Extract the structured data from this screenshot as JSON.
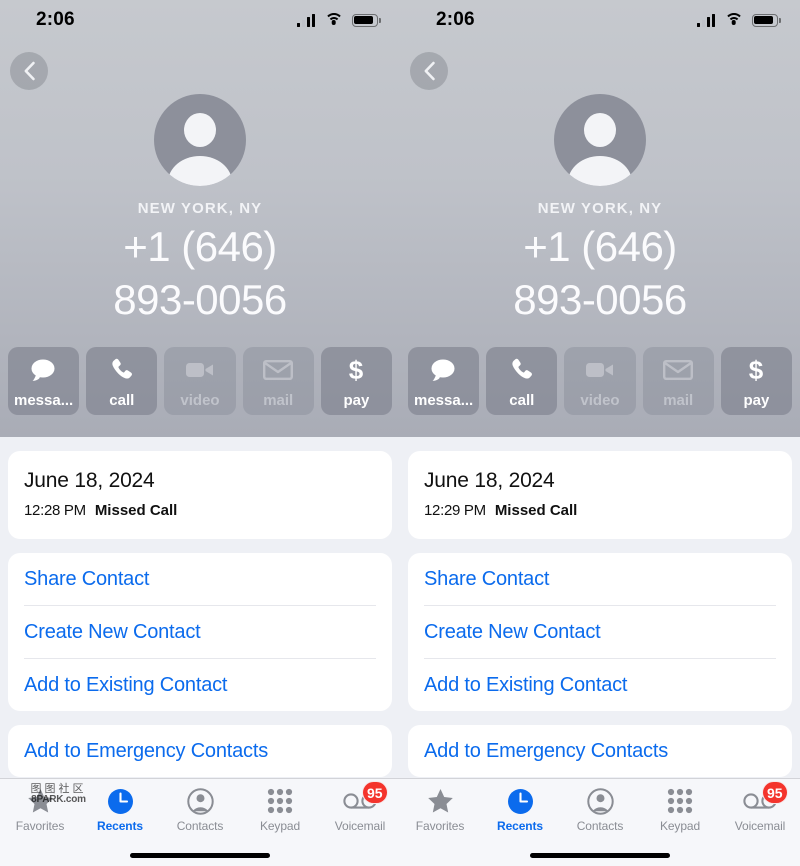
{
  "device": {
    "status_bar": {
      "time": "2:06",
      "signal_icon": "cellular-signal-icon",
      "wifi_icon": "wifi-icon",
      "battery_icon": "battery-icon"
    },
    "home_indicator": "home-indicator"
  },
  "colors": {
    "link_blue": "#0b6bed",
    "badge_red": "#f4342c",
    "hero_gray_top": "#c6c9ce",
    "hero_gray_bottom": "#a9acb6",
    "content_bg": "#eef0f5",
    "card_white": "#ffffff",
    "tab_inactive": "#8a8d94"
  },
  "watermark": {
    "cn_text": "图图社区",
    "en_text": "8PARK.com"
  },
  "panels": [
    {
      "id": "left",
      "back_button": "back-chevron",
      "avatar": "default-contact-avatar",
      "locality": "NEW YORK, NY",
      "phone_line1": "+1 (646)",
      "phone_line2": "893-0056",
      "actions": [
        {
          "label": "messa...",
          "icon": "message-bubble-icon",
          "enabled": true
        },
        {
          "label": "call",
          "icon": "phone-handset-icon",
          "enabled": true
        },
        {
          "label": "video",
          "icon": "video-camera-icon",
          "enabled": false
        },
        {
          "label": "mail",
          "icon": "envelope-icon",
          "enabled": false
        },
        {
          "label": "pay",
          "icon": "dollar-sign-icon",
          "enabled": true
        }
      ],
      "call_entry": {
        "date": "June 18, 2024",
        "time": "12:28 PM",
        "type": "Missed Call"
      },
      "contact_actions": [
        "Share Contact",
        "Create New Contact",
        "Add to Existing Contact"
      ],
      "emergency_action": "Add to Emergency Contacts",
      "tabs": [
        {
          "label": "Favorites",
          "icon": "star-icon",
          "active": false,
          "badge": null
        },
        {
          "label": "Recents",
          "icon": "clock-icon",
          "active": true,
          "badge": null
        },
        {
          "label": "Contacts",
          "icon": "person-circle-icon",
          "active": false,
          "badge": null
        },
        {
          "label": "Keypad",
          "icon": "keypad-grid-icon",
          "active": false,
          "badge": null
        },
        {
          "label": "Voicemail",
          "icon": "voicemail-icon",
          "active": false,
          "badge": "95"
        }
      ]
    },
    {
      "id": "right",
      "back_button": "back-chevron",
      "avatar": "default-contact-avatar",
      "locality": "NEW YORK, NY",
      "phone_line1": "+1 (646)",
      "phone_line2": "893-0056",
      "actions": [
        {
          "label": "messa...",
          "icon": "message-bubble-icon",
          "enabled": true
        },
        {
          "label": "call",
          "icon": "phone-handset-icon",
          "enabled": true
        },
        {
          "label": "video",
          "icon": "video-camera-icon",
          "enabled": false
        },
        {
          "label": "mail",
          "icon": "envelope-icon",
          "enabled": false
        },
        {
          "label": "pay",
          "icon": "dollar-sign-icon",
          "enabled": true
        }
      ],
      "call_entry": {
        "date": "June 18, 2024",
        "time": "12:29 PM",
        "type": "Missed Call"
      },
      "contact_actions": [
        "Share Contact",
        "Create New Contact",
        "Add to Existing Contact"
      ],
      "emergency_action": "Add to Emergency Contacts",
      "tabs": [
        {
          "label": "Favorites",
          "icon": "star-icon",
          "active": false,
          "badge": null
        },
        {
          "label": "Recents",
          "icon": "clock-icon",
          "active": true,
          "badge": null
        },
        {
          "label": "Contacts",
          "icon": "person-circle-icon",
          "active": false,
          "badge": null
        },
        {
          "label": "Keypad",
          "icon": "keypad-grid-icon",
          "active": false,
          "badge": null
        },
        {
          "label": "Voicemail",
          "icon": "voicemail-icon",
          "active": false,
          "badge": "95"
        }
      ]
    }
  ]
}
